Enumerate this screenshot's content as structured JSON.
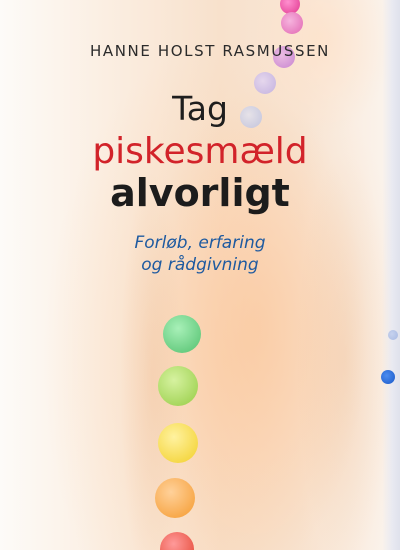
{
  "book": {
    "author": "HANNE HOLST RASMUSSEN",
    "title_line1": "Tag",
    "title_line2": "piskesmæld",
    "title_line3": "alvorligt",
    "subtitle_line1": "Forløb, erfaring",
    "subtitle_line2": "og rådgivning"
  },
  "colors": {
    "title_accent": "#d2232a",
    "subtitle": "#1e5aa0",
    "text_dark": "#1e1e1e"
  },
  "decor": {
    "chakra_dots": [
      "pink",
      "magenta",
      "violet",
      "lavender",
      "light-blue",
      "green",
      "lime",
      "yellow",
      "orange",
      "red",
      "blue"
    ]
  }
}
